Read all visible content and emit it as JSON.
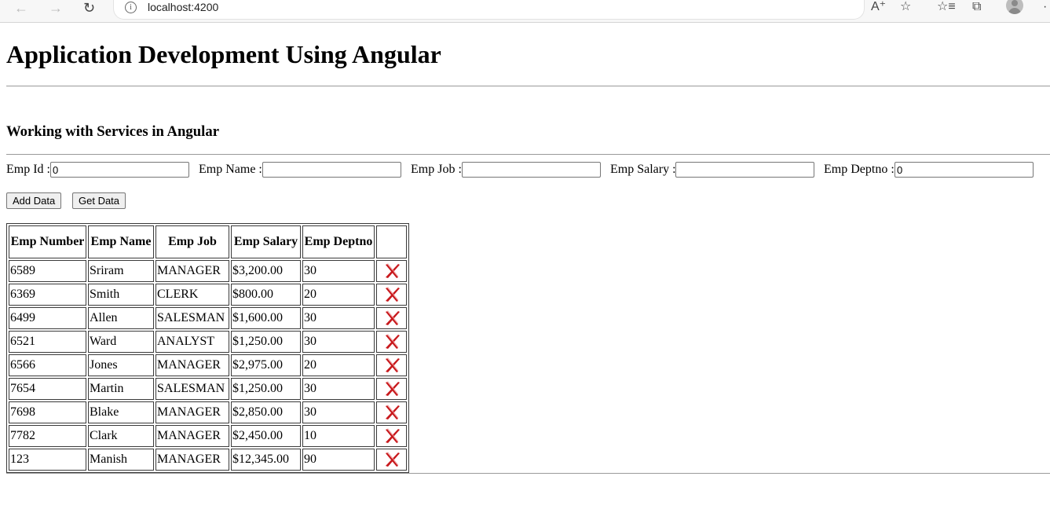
{
  "browser": {
    "url": "localhost:4200",
    "back_icon": "arrow-left-icon",
    "forward_icon": "arrow-right-icon",
    "reload_icon": "reload-icon",
    "info_icon": "info-icon"
  },
  "page": {
    "title": "Application Development Using Angular",
    "subtitle": "Working with Services in Angular"
  },
  "form": {
    "emp_id_label": "Emp Id :",
    "emp_id_value": "0",
    "emp_name_label": "Emp Name :",
    "emp_name_value": "",
    "emp_job_label": "Emp Job :",
    "emp_job_value": "",
    "emp_salary_label": "Emp Salary :",
    "emp_salary_value": "",
    "emp_deptno_label": "Emp Deptno :",
    "emp_deptno_value": "0"
  },
  "buttons": {
    "add": "Add Data",
    "get": "Get Data"
  },
  "table": {
    "headers": [
      "Emp Number",
      "Emp Name",
      "Emp Job",
      "Emp Salary",
      "Emp Deptno",
      ""
    ],
    "rows": [
      {
        "number": "6589",
        "name": "Sriram",
        "job": "MANAGER",
        "salary": "$3,200.00",
        "deptno": "30"
      },
      {
        "number": "6369",
        "name": "Smith",
        "job": "CLERK",
        "salary": "$800.00",
        "deptno": "20"
      },
      {
        "number": "6499",
        "name": "Allen",
        "job": "SALESMAN",
        "salary": "$1,600.00",
        "deptno": "30"
      },
      {
        "number": "6521",
        "name": "Ward",
        "job": "ANALYST",
        "salary": "$1,250.00",
        "deptno": "30"
      },
      {
        "number": "6566",
        "name": "Jones",
        "job": "MANAGER",
        "salary": "$2,975.00",
        "deptno": "20"
      },
      {
        "number": "7654",
        "name": "Martin",
        "job": "SALESMAN",
        "salary": "$1,250.00",
        "deptno": "30"
      },
      {
        "number": "7698",
        "name": "Blake",
        "job": "MANAGER",
        "salary": "$2,850.00",
        "deptno": "30"
      },
      {
        "number": "7782",
        "name": "Clark",
        "job": "MANAGER",
        "salary": "$2,450.00",
        "deptno": "10"
      },
      {
        "number": "123",
        "name": "Manish",
        "job": "MANAGER",
        "salary": "$12,345.00",
        "deptno": "90"
      }
    ],
    "delete_icon": "delete-x-icon",
    "delete_color": "#c8191d"
  }
}
